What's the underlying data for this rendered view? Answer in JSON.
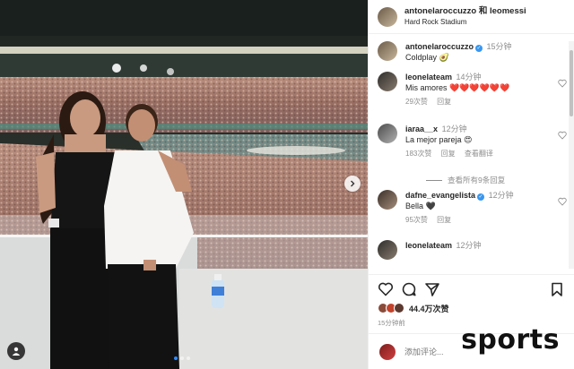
{
  "post": {
    "header_users": "antonelaroccuzzo 和 leomessi",
    "location": "Hard Rock Stadium"
  },
  "caption": {
    "user": "antonelaroccuzzo",
    "time": "15分钟",
    "text": "Coldplay 🥑",
    "verified": true
  },
  "comments": [
    {
      "user": "leonelateam",
      "time": "14分钟",
      "text": "Mis amores ❤️❤️❤️❤️❤️❤️",
      "likes": "29次赞",
      "reply": "回复"
    },
    {
      "user": "iaraa__x",
      "time": "12分钟",
      "text": "La mejor pareja 😍",
      "likes": "183次赞",
      "reply": "回复",
      "translate": "查看翻译",
      "view_replies": "查看所有9条回复"
    },
    {
      "user": "dafne_evangelista",
      "time": "12分钟",
      "text": "Bella 🖤",
      "likes": "95次赞",
      "reply": "回复",
      "verified": true
    },
    {
      "user": "leonelateam",
      "time": "12分钟"
    }
  ],
  "likes_count": "44.4万次赞",
  "post_age": "15分钟前",
  "add_comment_placeholder": "添加评论...",
  "watermark": "sports",
  "icons": [
    "heart-icon",
    "comment-icon",
    "share-icon",
    "bookmark-icon",
    "tag-user-icon",
    "chevron-right-icon",
    "verified-icon"
  ],
  "colors": {
    "verified": "#3897f0",
    "secondary_text": "#8e8e8e",
    "carousel_active": "#2f8bff"
  }
}
